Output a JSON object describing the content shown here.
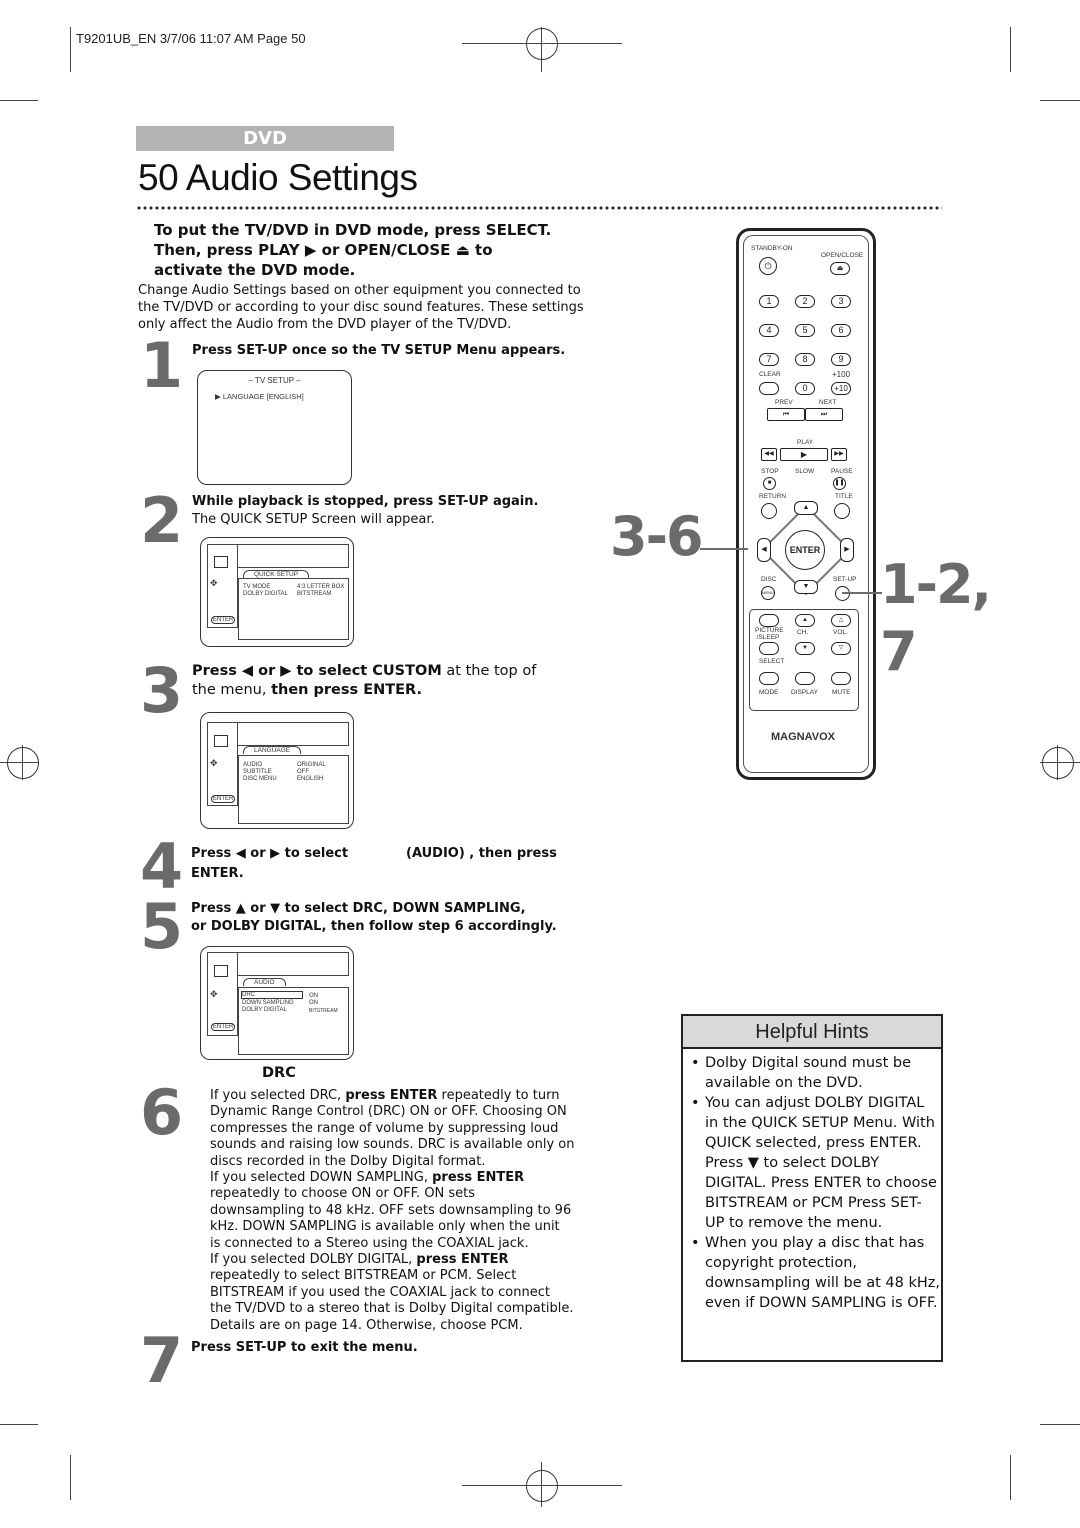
{
  "header": {
    "slug": "T9201UB_EN 3/7/06 11:07 AM Page 50"
  },
  "section_tag": "DVD",
  "page_title": "50  Audio Settings",
  "intro": {
    "bold_lines": [
      "To put the TV/DVD in DVD mode, press SELECT.",
      "Then, press PLAY ▶ or OPEN/CLOSE ⏏ to",
      "activate the DVD mode."
    ],
    "paragraph": "Change Audio Settings based on other equipment you connected to the TV/DVD or according to your disc sound features. These settings only affect the Audio from the DVD player of the TV/DVD."
  },
  "steps": [
    {
      "number": "1",
      "text": "Press SET-UP once so the TV SETUP Menu appears."
    },
    {
      "number": "2",
      "bold": "While playback is stopped, press SET-UP again.",
      "text": "The QUICK SETUP Screen will appear."
    },
    {
      "number": "3",
      "bold1": "Press ◀ or ▶ to select CUSTOM",
      "text1": " at the top of",
      "text2": "the menu, ",
      "bold2": "then press ENTER."
    },
    {
      "number": "4",
      "line1a": "Press ◀ or ▶ to select",
      "line1b": "(AUDIO) , then press",
      "line2": "ENTER."
    },
    {
      "number": "5",
      "line1": "Press ▲ or ▼ to select DRC, DOWN SAMPLING,",
      "line2": "or DOLBY DIGITAL, then follow step 6 accordingly."
    },
    {
      "number": "6",
      "heading": "DRC",
      "lines": [
        [
          "If you selected DRC, ",
          "press ENTER",
          " repeatedly to turn"
        ],
        [
          "Dynamic Range Control (DRC) ON or OFF. Choosing ON",
          "",
          ""
        ],
        [
          "compresses the range of volume by suppressing loud",
          "",
          ""
        ],
        [
          "sounds and raising low sounds. DRC is available only on",
          "",
          ""
        ],
        [
          "discs recorded in the Dolby Digital format.",
          "",
          ""
        ],
        [
          "If you selected DOWN SAMPLING, ",
          "press ENTER",
          ""
        ],
        [
          "repeatedly to choose ON or OFF. ON sets",
          "",
          ""
        ],
        [
          "downsampling to 48 kHz. OFF sets downsampling to 96",
          "",
          ""
        ],
        [
          "kHz. DOWN SAMPLING is available only when the unit",
          "",
          ""
        ],
        [
          "is connected to a Stereo using the COAXIAL jack.",
          "",
          ""
        ],
        [
          "If you selected DOLBY DIGITAL, ",
          "press ENTER",
          ""
        ],
        [
          "repeatedly to select BITSTREAM or PCM. Select",
          "",
          ""
        ],
        [
          "BITSTREAM if you used the COAXIAL jack to connect",
          "",
          ""
        ],
        [
          "the TV/DVD to a stereo that is Dolby Digital compatible.",
          "",
          ""
        ],
        [
          "Details are on page 14. Otherwise, choose PCM.",
          "",
          ""
        ]
      ]
    },
    {
      "number": "7",
      "text": "Press SET-UP to exit the menu."
    }
  ],
  "screens": {
    "tv_setup": {
      "title": "– TV SETUP –",
      "item": "▶  LANGUAGE  [ENGLISH]"
    },
    "quick_setup": {
      "tab": "QUICK SETUP",
      "rows": [
        [
          "TV MODE",
          "4:3 LETTER BOX"
        ],
        [
          "DOLBY DIGITAL",
          "BITSTREAM"
        ]
      ],
      "enter": "ENTER"
    },
    "language": {
      "tab": "LANGUAGE",
      "rows": [
        [
          "AUDIO",
          "ORIGINAL"
        ],
        [
          "SUBTITLE",
          "OFF"
        ],
        [
          "DISC MENU",
          "ENGLISH"
        ]
      ],
      "enter": "ENTER"
    },
    "audio": {
      "tab": "AUDIO",
      "rows": [
        [
          "DRC",
          "ON"
        ],
        [
          "DOWN SAMPLING",
          "ON"
        ],
        [
          "DOLBY DIGITAL",
          "BITSTREAM"
        ]
      ],
      "enter": "ENTER"
    }
  },
  "remote": {
    "standby": "STANDBY-ON",
    "open_close": "OPEN/CLOSE",
    "digits": [
      "1",
      "2",
      "3",
      "4",
      "5",
      "6",
      "7",
      "8",
      "9"
    ],
    "clear": "CLEAR",
    "zero": "0",
    "plus100": "+100",
    "plus10": "+10",
    "prev": "PREV",
    "next": "NEXT",
    "play": "PLAY",
    "stop": "STOP",
    "slow": "SLOW",
    "pause": "PAUSE",
    "return": "RETURN",
    "title": "TITLE",
    "enter": "ENTER",
    "disc": "DISC",
    "menu": "MENU",
    "setup": "SET-UP",
    "picture_sleep": "PICTURE /SLEEP",
    "ch": "CH.",
    "vol": "VOL.",
    "select": "SELECT",
    "mode": "MODE",
    "display": "DISPLAY",
    "mute": "MUTE",
    "brand": "MAGNAVOX"
  },
  "callouts": {
    "left": "3-6",
    "right_top": "1-2,",
    "right_bottom": "7"
  },
  "hints": {
    "title": "Helpful Hints",
    "items": [
      "Dolby Digital sound must be available on the DVD.",
      "You can adjust DOLBY DIGITAL in the QUICK SETUP Menu. With QUICK selected, press ENTER. Press ▼ to select DOLBY DIGITAL. Press ENTER to choose BITSTREAM or PCM Press SET-UP to remove the menu.",
      "When you play a disc that has copyright protection, downsampling will be at 48 kHz, even if DOWN SAMPLING is OFF."
    ]
  },
  "colors": {
    "band": "#b3b3b3",
    "step_number": "#6b6b6b",
    "hint_header": "#d9d9d9"
  }
}
